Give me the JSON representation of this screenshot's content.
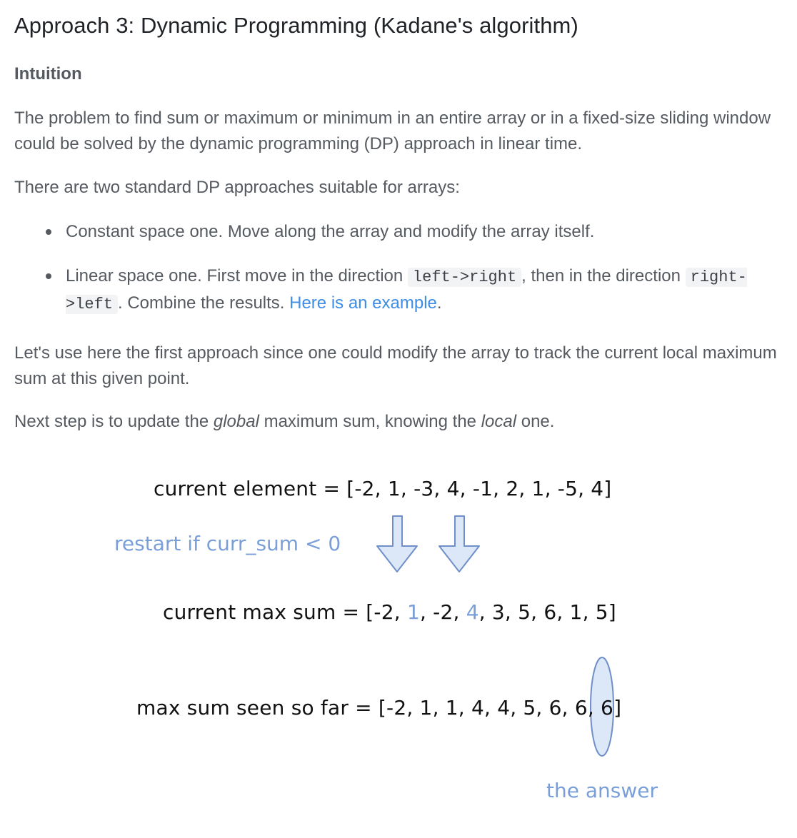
{
  "title": "Approach 3: Dynamic Programming (Kadane's algorithm)",
  "section": "Intuition",
  "para1": "The problem to find sum or maximum or minimum in an entire array or in a fixed-size sliding window could be solved by the dynamic programming (DP) approach in linear time.",
  "para2": "There are two standard DP approaches suitable for arrays:",
  "bullet1": "Constant space one. Move along the array and modify the array itself.",
  "bullet2": {
    "part1": "Linear space one. First move in the direction",
    "code1": "left->right",
    "part2": ", then in the direction",
    "code2": "right->left",
    "part3": ". Combine the results.",
    "link": "Here is an example",
    "part4": "."
  },
  "para3": "Let's use here the first approach since one could modify the array to track the current local maximum sum at this given point.",
  "para4": {
    "part1": "Next step is to update the",
    "em1": "global",
    "part2": "maximum sum, knowing the",
    "em2": "local",
    "part3": "one."
  },
  "diagram": {
    "row1": "current element = [-2, 1, -3, 4, -1, 2, 1, -5, 4]",
    "note_restart": "restart if curr_sum < 0",
    "row2": {
      "prefix": "current max sum = [-2, ",
      "hl1": "1",
      "mid": ", -2, ",
      "hl2": "4",
      "suffix": ", 3, 5, 6, 1, 5]"
    },
    "row3": "max sum seen so far = [-2, 1, 1, 4, 4, 5, 6, 6, 6]",
    "note_answer": "the answer"
  },
  "colors": {
    "text": "#555a60",
    "heading": "#1f2328",
    "link": "#3d8ee6",
    "annotation": "#7a9fd8",
    "arrow_fill": "#dce7f8",
    "arrow_stroke": "#6f8fc9"
  }
}
